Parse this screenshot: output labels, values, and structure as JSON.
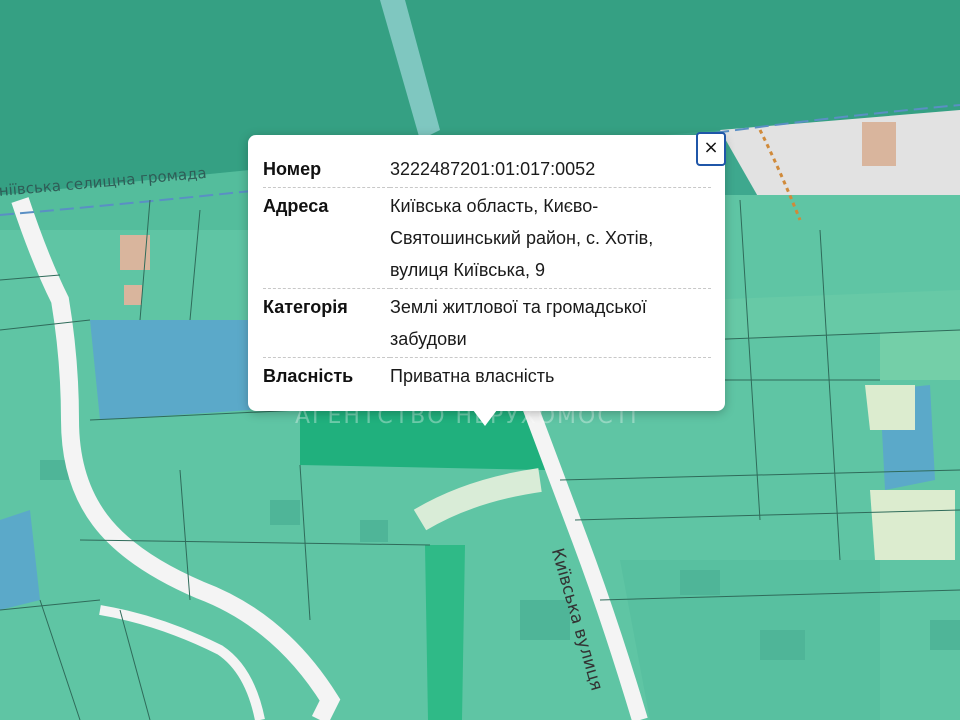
{
  "map": {
    "street_label": "Київська вулиця",
    "community_label": "ніївська селищна громада",
    "watermark": "АГЕНТСТВО НЕРУХОМОСТІ",
    "colors": {
      "parcel_residential": "#5fc5a4",
      "parcel_selected": "#20b07d",
      "forest": "#3ea88e",
      "water": "#5ba9c9",
      "road": "#f4f4f4",
      "building": "#d9b59d"
    }
  },
  "popup": {
    "close_label": "×",
    "rows": [
      {
        "key": "Номер",
        "value": "3222487201:01:017:0052"
      },
      {
        "key": "Адреса",
        "value": "Київська область, Києво-Святошинський район, с. Хотів, вулиця Київська, 9"
      },
      {
        "key": "Категорія",
        "value": "Землі житлової та громадської забудови"
      },
      {
        "key": "Власність",
        "value": "Приватна власність"
      }
    ]
  }
}
